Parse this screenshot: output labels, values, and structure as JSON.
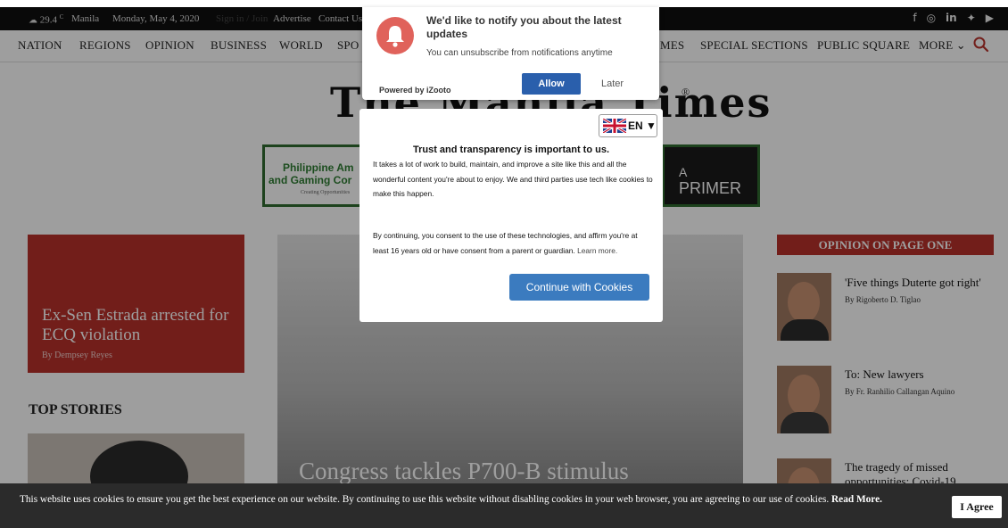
{
  "topbar": {
    "weather_temp": "29.4",
    "weather_unit": "C",
    "city": "Manila",
    "date": "Monday, May 4, 2020",
    "signin": "Sign in / Join",
    "advertise": "Advertise",
    "contact": "Contact Us",
    "social_icons": [
      "facebook-icon",
      "instagram-icon",
      "linkedin-icon",
      "twitter-icon",
      "youtube-icon"
    ]
  },
  "nav": {
    "items_left": [
      "NATION",
      "REGIONS",
      "OPINION",
      "BUSINESS",
      "WORLD",
      "SPO"
    ],
    "items_right": [
      "MES",
      "SPECIAL SECTIONS",
      "PUBLIC SQUARE",
      "MORE ⌄"
    ]
  },
  "masthead": {
    "title": "The Manila Times",
    "reg": "®"
  },
  "ads": {
    "left_line1": "Philippine Am",
    "left_line2": "and Gaming Cor",
    "left_line3": "Creating Opportunities",
    "right_a": "A",
    "right_b": "PRIMER"
  },
  "feature": {
    "title": "Ex-Sen Estrada arrested for ECQ violation",
    "byline": "By Dempsey Reyes"
  },
  "top_stories": "TOP STORIES",
  "hero": {
    "title": "Congress tackles P700-B stimulus"
  },
  "opinion": {
    "header": "OPINION ON PAGE ONE",
    "items": [
      {
        "title": "'Five things Duterte got right'",
        "byline": "By Rigoberto D. Tiglao"
      },
      {
        "title": "To: New lawyers",
        "byline": "By Fr. Ranhilio Callangan Aquino"
      },
      {
        "title": "The tragedy of missed",
        "byline": "opportunities: Covid-19"
      }
    ]
  },
  "notify": {
    "title": "We'd like to notify you about the latest updates",
    "subtitle": "You can unsubscribe from notifications anytime",
    "powered": "Powered by iZooto",
    "allow": "Allow",
    "later": "Later"
  },
  "consent": {
    "language": "EN ▼",
    "title": "Trust and transparency is important to us.",
    "para1": "It takes a lot of work to build, maintain, and improve a site like this and all the wonderful content you're about to enjoy. We and third parties use tech like cookies to make this happen.",
    "para2": "By continuing, you consent to the use of these technologies, and affirm you're at least 16 years old or have consent from a parent or guardian.",
    "learn_more": "Learn more.",
    "continue": "Continue with Cookies"
  },
  "cookiebar": {
    "text": "This website uses cookies to ensure you get the best experience on our website. By continuing to use this website without disabling cookies in your web browser, you are agreeing to our use of cookies.",
    "read_more": "Read More.",
    "agree": "I Agree"
  },
  "colors": {
    "brand_red": "#b8312b",
    "allow_blue": "#2a5fac",
    "continue_blue": "#3b7bbf",
    "notify_bell": "#e0625b"
  }
}
